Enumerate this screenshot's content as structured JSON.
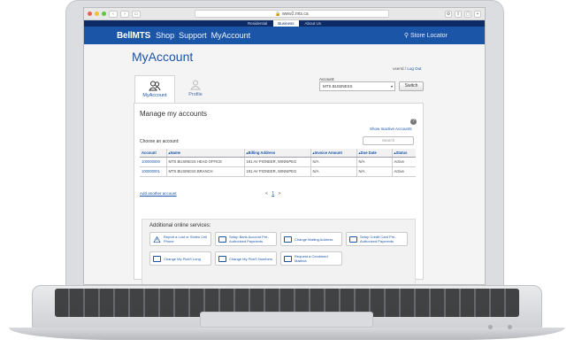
{
  "browser": {
    "url": "www2.mts.ca"
  },
  "site": {
    "top_tabs": [
      "Residential",
      "Business",
      "About Us"
    ],
    "active_top_tab": 1,
    "logo": "BellMTS",
    "nav": [
      "Shop",
      "Support",
      "MyAccount"
    ],
    "store_locator": "Store Locator"
  },
  "page": {
    "title": "MyAccount",
    "user_id": "userId",
    "separator": "/",
    "logout": "Log Out",
    "account_label": "Account:",
    "account_selected": "MTS BUSINESS",
    "switch_button": "Switch",
    "tabs": [
      {
        "label": "MyAccount",
        "icon": "users-icon"
      },
      {
        "label": "Profile",
        "icon": "profile-icon"
      }
    ]
  },
  "manage": {
    "title": "Manage my accounts",
    "show_inactive": "Show Inactive Accounts",
    "choose": "Choose an account:",
    "search_placeholder": "Search",
    "columns": [
      "Account",
      "Name",
      "Billing Address",
      "Invoice Amount",
      "Due Date",
      "Status"
    ],
    "rows": [
      [
        "100000000",
        "MTS BUSINESS HEAD OFFICE",
        "191 AV PIONEER, WINNIPEG",
        "N/A",
        "N/A",
        "Active"
      ],
      [
        "100000001",
        "MTS BUSINESS BRANCH",
        "191 AV PIONEER, WINNIPEG",
        "N/A",
        "N/A",
        "Active"
      ]
    ],
    "add_account": "Add another account",
    "pager": {
      "prev": "<",
      "current": "1",
      "next": ">"
    }
  },
  "services": {
    "title": "Additional online services:",
    "items": [
      {
        "label": "Report a Lost or Stolen Cell Phone",
        "icon": "warning-icon"
      },
      {
        "label": "Setup Bank Account Pre-Authorized Payments",
        "icon": "bank-icon"
      },
      {
        "label": "Change Mailing Address",
        "icon": "mail-icon"
      },
      {
        "label": "Setup Credit Card Pre-Authorized Payments",
        "icon": "credit-card-icon"
      },
      {
        "label": "Change My PickS Long",
        "icon": "phone-icon"
      },
      {
        "label": "Change My PickS Numbers",
        "icon": "phone-icon"
      },
      {
        "label": "Request a Combined Mailbox",
        "icon": "mailbox-icon"
      }
    ]
  }
}
